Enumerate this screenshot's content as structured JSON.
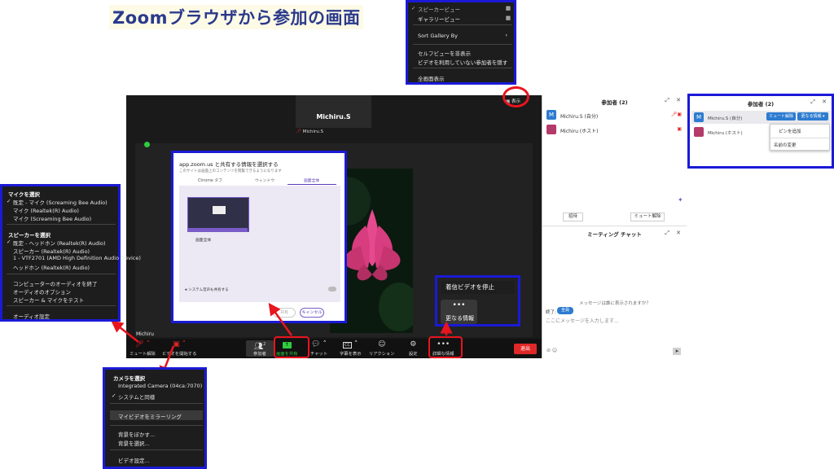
{
  "page_title": "Zoomブラウザから参加の画面",
  "view_menu": {
    "items": [
      "スピーカービュー",
      "ギャラリービュー",
      "Sort Gallery By",
      "セルフビューを非表示",
      "ビデオを利用していない参加者を隠す",
      "全画面表示"
    ],
    "checked": "✓",
    "chevron": "›"
  },
  "main": {
    "speaker_name": "Michiru.S",
    "speaker_label": "Michiru.S",
    "view_button": "表示",
    "self_name": "Michiru"
  },
  "toolbar": {
    "items": [
      "ミュート解除",
      "ビデオを開始する",
      "参加者",
      "画面を共有",
      "チャット",
      "字幕を表示",
      "リアクション",
      "設定",
      "詳細な情報"
    ],
    "participants_count": "2",
    "cc_label": "CC",
    "end": "退出"
  },
  "share_dialog": {
    "title": "app.zoom.us と共有する情報を選択する",
    "subtitle": "このサイトは画面上のコンテンツを閲覧できるようになります",
    "tabs": [
      "Chrome タブ",
      "ウィンドウ",
      "画面全体"
    ],
    "thumb_label": "画面全体",
    "audio_label": "システム音声も共有する",
    "share_button": "共有",
    "cancel_button": "キャンセル"
  },
  "stop_video": {
    "label": "着信ビデオを停止",
    "more_dots": "•••",
    "more_label": "更なる情報"
  },
  "participants_panel": {
    "title": "参加者 (2)",
    "rows": [
      {
        "initial": "M",
        "name": "Michiru.S (自分)"
      },
      {
        "initial": "",
        "name": "Michiru (ホスト)"
      }
    ],
    "invite": "招待",
    "mute_all": "ミュート解除",
    "chat_title": "ミーティング チャット",
    "chat_who": "メッセージは誰に表示されますか？",
    "chat_to": "終了:",
    "chat_everyone": "全員",
    "chat_placeholder": "ここにメッセージを入力します..."
  },
  "participants_popup": {
    "title": "参加者 (2)",
    "row1_name": "Michiru.S (自分)",
    "row2_name": "Michiru (ホスト)",
    "unmute": "ミュート解除",
    "more": "更なる情報 ▾",
    "dropdown": [
      "ピンを追加",
      "名前の変更"
    ]
  },
  "audio_menu": {
    "mic_header": "マイクを選択",
    "mics": [
      "既定 - マイク (Screaming Bee Audio)",
      "マイク (Realtek(R) Audio)",
      "マイク (Screaming Bee Audio)"
    ],
    "speaker_header": "スピーカーを選択",
    "speakers": [
      "既定 - ヘッドホン (Realtek(R) Audio)",
      "スピーカー (Realtek(R) Audio)",
      "1 - VTF2701 (AMD High Definition Audio Device)",
      "ヘッドホン (Realtek(R) Audio)"
    ],
    "options": [
      "コンピューターのオーディオを終了",
      "オーディオのオプション",
      "スピーカー & マイクをテスト"
    ],
    "settings": "オーディオ設定"
  },
  "camera_menu": {
    "header": "カメラを選択",
    "cameras": [
      "Integrated Camera (04ca:7070)",
      "システムと同様"
    ],
    "mirror": "マイビデオをミラーリング",
    "bg": [
      "背景をぼかす...",
      "背景を選択..."
    ],
    "settings": "ビデオ設定..."
  },
  "colors": {
    "highlight_blue": "#1a1ad6",
    "highlight_red": "#e8141e",
    "zoom_blue": "#2d7bd0",
    "end_red": "#e02828"
  }
}
